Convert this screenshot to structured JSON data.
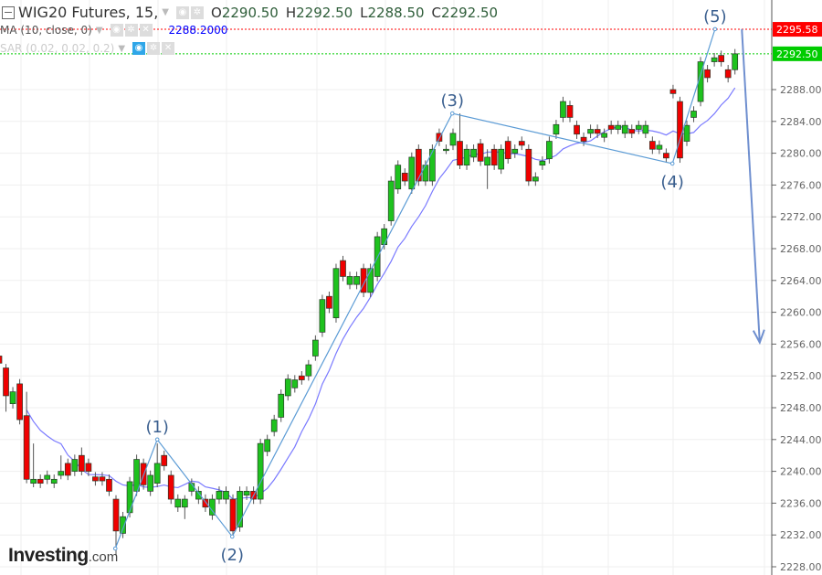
{
  "header": {
    "symbol": "WIG20 Futures, 15,",
    "open_label": "O",
    "open": "2290.50",
    "high_label": "H",
    "high": "2292.50",
    "low_label": "L",
    "low": "2288.50",
    "close_label": "C",
    "close": "2292.50"
  },
  "indicators": {
    "ma_label": "MA (10, close, 0)",
    "ma_value": "2288.2000",
    "sar_label": "SAR (0.02, 0.02, 0.2)"
  },
  "logo": {
    "main": "Investing",
    "suffix": ".com"
  },
  "colors": {
    "up": "#1ec21e",
    "down": "#f00000",
    "ma": "#7a7aff",
    "wave": "#5b9bd5",
    "arrow": "#6f8fcf",
    "red_line": "#ff0000",
    "green_line": "#00cc00"
  },
  "chart_data": {
    "type": "candlestick",
    "title": "WIG20 Futures, 15",
    "ylim": [
      2227,
      2299
    ],
    "y_ticks": [
      "2288.00",
      "2284.00",
      "2280.00",
      "2276.00",
      "2272.00",
      "2268.00",
      "2264.00",
      "2260.00",
      "2256.00",
      "2252.00",
      "2248.00",
      "2244.00",
      "2240.00",
      "2236.00",
      "2232.00",
      "2228.00"
    ],
    "price_lines": [
      {
        "label": "2295.58",
        "value": 2295.58,
        "color": "#ff0000"
      },
      {
        "label": "2292.50",
        "value": 2292.5,
        "color": "#00cc00"
      }
    ],
    "candles_oc": [
      [
        2254.5,
        2253.6
      ],
      [
        2253,
        2249.5
      ],
      [
        2248.5,
        2250
      ],
      [
        2251,
        2246.5
      ],
      [
        2247,
        2239
      ],
      [
        2238.5,
        2239
      ],
      [
        2239,
        2238.5
      ],
      [
        2239,
        2239.5
      ],
      [
        2238.5,
        2239
      ],
      [
        2239.5,
        2240
      ],
      [
        2241,
        2239.5
      ],
      [
        2240,
        2241.5
      ],
      [
        2242,
        2240
      ],
      [
        2241,
        2240
      ],
      [
        2239.3,
        2238.8
      ],
      [
        2239.3,
        2238.8
      ],
      [
        2239,
        2237.5
      ],
      [
        2236.5,
        2232.5
      ],
      [
        2232.2,
        2234.3
      ],
      [
        2234.8,
        2238.7
      ],
      [
        2237.5,
        2241.5
      ],
      [
        2241,
        2238.3
      ],
      [
        2237.5,
        2239.5
      ],
      [
        2238.5,
        2241
      ],
      [
        2242,
        2240.7
      ],
      [
        2239.5,
        2236.5
      ],
      [
        2235.5,
        2236.5
      ],
      [
        2235.5,
        2236.5
      ],
      [
        2237.5,
        2238.5
      ],
      [
        2236.5,
        2237.5
      ],
      [
        2236.5,
        2235.5
      ],
      [
        2234.5,
        2236.5
      ],
      [
        2236.5,
        2237.5
      ],
      [
        2236.5,
        2237.5
      ],
      [
        2236.5,
        2232.5
      ],
      [
        2233,
        2237.5
      ],
      [
        2237,
        2237.5
      ],
      [
        2237.5,
        2236.5
      ],
      [
        2236.5,
        2243.5
      ],
      [
        2242.5,
        2244
      ],
      [
        2245,
        2246.5
      ],
      [
        2246.8,
        2249.7
      ],
      [
        2249.5,
        2251.6
      ],
      [
        2250.5,
        2251.5
      ],
      [
        2252,
        2251.5
      ],
      [
        2252,
        2253.4
      ],
      [
        2254.5,
        2256.5
      ],
      [
        2257.5,
        2261.6
      ],
      [
        2262,
        2260.5
      ],
      [
        2259.3,
        2265.5
      ],
      [
        2266.5,
        2264.5
      ],
      [
        2263.5,
        2264.5
      ],
      [
        2263.5,
        2264.5
      ],
      [
        2265.5,
        2262.5
      ],
      [
        2262.5,
        2265.5
      ],
      [
        2264.5,
        2269.5
      ],
      [
        2268.5,
        2270.5
      ],
      [
        2271.5,
        2276.5
      ],
      [
        2275.5,
        2278.5
      ],
      [
        2277.5,
        2276.5
      ],
      [
        2275.5,
        2279.5
      ],
      [
        2280.5,
        2276.5
      ],
      [
        2276.5,
        2278.5
      ],
      [
        2276.5,
        2280.5
      ],
      [
        2282.5,
        2281.5
      ],
      [
        2280.5,
        2280.5
      ],
      [
        2281,
        2282.5
      ],
      [
        2281.5,
        2278.5
      ],
      [
        2278.5,
        2280.5
      ],
      [
        2279.5,
        2280.5
      ],
      [
        2281.2,
        2279
      ],
      [
        2278.5,
        2279.5
      ],
      [
        2280.5,
        2278.5
      ],
      [
        2278,
        2280.5
      ],
      [
        2281.5,
        2279.3
      ],
      [
        2280,
        2280.5
      ],
      [
        2281.5,
        2281
      ],
      [
        2280.5,
        2276.5
      ],
      [
        2276.5,
        2277
      ],
      [
        2278.5,
        2279
      ],
      [
        2279.3,
        2281.5
      ],
      [
        2282.4,
        2283.6
      ],
      [
        2284.5,
        2286.5
      ],
      [
        2286,
        2284.5
      ],
      [
        2283.5,
        2282.4
      ],
      [
        2282,
        2281.5
      ],
      [
        2282.5,
        2283
      ],
      [
        2283,
        2282.5
      ],
      [
        2282,
        2282.5
      ],
      [
        2283.5,
        2283
      ],
      [
        2283,
        2283.5
      ],
      [
        2282.5,
        2283.5
      ],
      [
        2283,
        2282.5
      ],
      [
        2283,
        2283.5
      ],
      [
        2282.5,
        2283.5
      ],
      [
        2281.5,
        2280.5
      ],
      [
        2280.5,
        2281
      ],
      [
        2280,
        2279.4
      ],
      [
        2288,
        2287.5
      ],
      [
        2286.5,
        2279.4
      ],
      [
        2281.5,
        2283.5
      ],
      [
        2284.5,
        2285.3
      ],
      [
        2286.5,
        2291.5
      ],
      [
        2290.5,
        2289.5
      ],
      [
        2291.5,
        2292
      ],
      [
        2292.3,
        2291.5
      ],
      [
        2290.5,
        2289.5
      ],
      [
        2290.5,
        2292.5
      ]
    ],
    "wick_overrides": {
      "1": [
        2253.5,
        2247.5
      ],
      "4": [
        2250,
        2238.5
      ],
      "5": [
        2243.5,
        2238
      ],
      "9": [
        2242,
        2239
      ],
      "12": [
        2243,
        2239.5
      ],
      "17": [
        2237,
        2229.5
      ],
      "23": [
        2243.5,
        2238
      ],
      "27": [
        2237,
        2234
      ],
      "67": [
        2285,
        2278
      ],
      "71": [
        2280.5,
        2275.5
      ]
    },
    "ma_period": 10,
    "ma_last": 2288.2,
    "wave_points": [
      {
        "label": "",
        "index": 16.9,
        "price": 2230.3
      },
      {
        "label": "(1)",
        "index": 23.0,
        "price": 2244.0
      },
      {
        "label": "(2)",
        "index": 33.9,
        "price": 2231.8
      },
      {
        "label": "(3)",
        "index": 65.9,
        "price": 2285.0
      },
      {
        "label": "(4)",
        "index": 97.9,
        "price": 2278.7
      },
      {
        "label": "(5)",
        "index": 104.1,
        "price": 2295.6
      }
    ],
    "forecast_arrow": {
      "from": {
        "index": 108.0,
        "price": 2295.6
      },
      "to": {
        "index": 110.6,
        "price": 2256.2
      }
    }
  }
}
